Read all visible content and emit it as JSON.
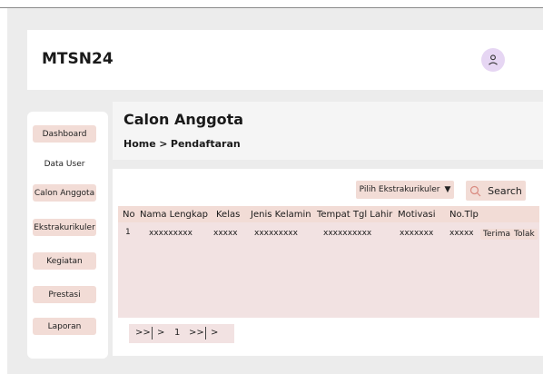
{
  "app": {
    "name": "MTSN24"
  },
  "sidebar": {
    "items": [
      {
        "label": "Dashboard"
      },
      {
        "label": "Data User"
      },
      {
        "label": "Calon Anggota"
      },
      {
        "label": "Ekstrakurikuler"
      },
      {
        "label": "Kegiatan"
      },
      {
        "label": "Prestasi"
      },
      {
        "label": "Laporan"
      }
    ]
  },
  "page": {
    "title": "Calon Anggota",
    "breadcrumb": {
      "home": "Home",
      "separator": ">",
      "current": "Pendaftaran"
    }
  },
  "toolbar": {
    "filter_label": "Pilih Ekstrakurikuler",
    "filter_arrow": "▼",
    "search_label": "Search"
  },
  "table": {
    "columns": [
      "No",
      "Nama Lengkap",
      "Kelas",
      "Jenis Kelamin",
      "Tempat Tgl Lahir",
      "Motivasi",
      "No.Tlp"
    ],
    "rows": [
      {
        "cells": [
          "1",
          "xxxxxxxxx",
          "xxxxx",
          "xxxxxxxxx",
          "xxxxxxxxxx",
          "xxxxxxx",
          "xxxxx"
        ],
        "accept": "Terima",
        "reject": "Tolak"
      }
    ]
  },
  "pagination": {
    "first": ">>",
    "prev": ">",
    "page": "1",
    "next": ">>",
    "last": ">"
  },
  "colors": {
    "accent": "#f2dcd6",
    "table_bg": "#f2e2e2",
    "frame_bg": "#ececec",
    "avatar_bg": "#e6d6f3"
  }
}
